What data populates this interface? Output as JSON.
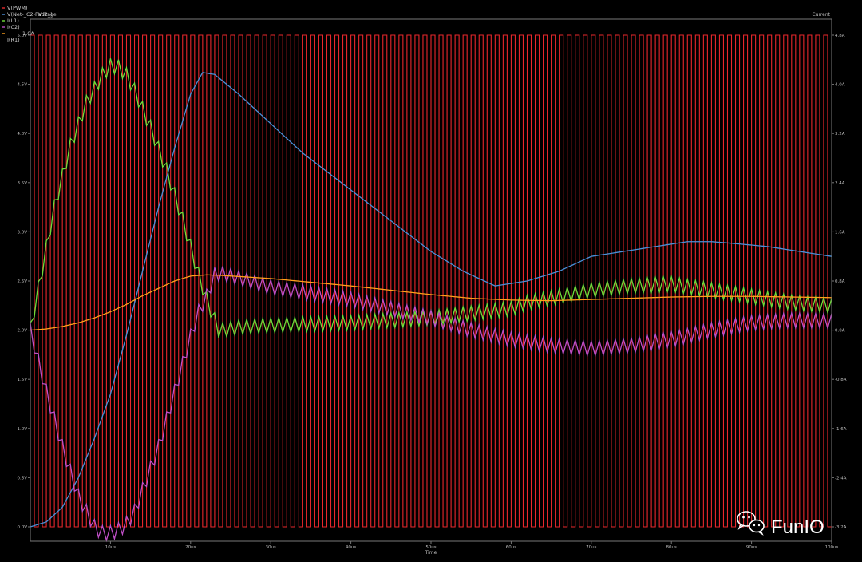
{
  "chart_data": {
    "type": "line",
    "left_axis_title": "Voltage",
    "right_axis_title": "Current",
    "x_axis_title": "Time",
    "x_ticks": [
      "10us",
      "20us",
      "30us",
      "40us",
      "50us",
      "60us",
      "70us",
      "80us",
      "90us",
      "100us"
    ],
    "left_ticks": [
      "0.0V",
      "0.5V",
      "1.0V",
      "1.5V",
      "2.0V",
      "2.5V",
      "3.0V",
      "3.5V",
      "4.0V",
      "4.5V",
      "5.0V"
    ],
    "right_ticks": [
      "-3.2A",
      "-2.4A",
      "-1.6A",
      "-0.8A",
      "0.0A",
      "0.8A",
      "1.6A",
      "2.4A",
      "3.2A",
      "4.0A",
      "4.8A"
    ],
    "xlim": [
      0,
      100
    ],
    "left_ylim": [
      0,
      5.0
    ],
    "right_ylim": [
      -3.2,
      4.8
    ],
    "grid": false,
    "legend_placement": "top-left",
    "legend": [
      "V(PWM)",
      "V(Net-_C2-Pad2_)",
      "I(L1)",
      "I(C2)",
      "I(R1)"
    ],
    "legend_extra": "1.0A",
    "colors": {
      "pwm": "#e8272c",
      "net": "#4a90d9",
      "il1": "#6fdc3a",
      "ic2": "#c04fc8",
      "ir1": "#ff9f1a",
      "background": "#000000",
      "axis": "#777777"
    },
    "series": [
      {
        "name": "V(PWM)",
        "axis": "left",
        "kind": "square_wave",
        "low": 0,
        "high": 5.0,
        "period_us": 1.0,
        "duty": 0.5
      },
      {
        "name": "V(Net-_C2-Pad2_)",
        "axis": "left",
        "x": [
          0,
          2,
          4,
          6,
          8,
          10,
          12,
          14,
          16,
          18,
          20,
          21.5,
          23,
          26,
          30,
          34,
          38,
          42,
          46,
          50,
          54,
          58,
          62,
          66,
          70,
          74,
          78,
          82,
          85,
          88,
          92,
          96,
          100
        ],
        "y": [
          0.0,
          0.05,
          0.2,
          0.5,
          0.9,
          1.35,
          1.95,
          2.6,
          3.25,
          3.85,
          4.4,
          4.62,
          4.6,
          4.4,
          4.1,
          3.8,
          3.55,
          3.3,
          3.05,
          2.8,
          2.6,
          2.45,
          2.5,
          2.6,
          2.75,
          2.8,
          2.85,
          2.9,
          2.9,
          2.88,
          2.85,
          2.8,
          2.75
        ]
      },
      {
        "name": "I(L1)",
        "axis": "right",
        "x": [
          0,
          1.5,
          3,
          5,
          7,
          9,
          10,
          11,
          12,
          13,
          15,
          17,
          19,
          21,
          22,
          23.5,
          24,
          26,
          30,
          40,
          50,
          60,
          62,
          66,
          70,
          75,
          80,
          85,
          90,
          95,
          100
        ],
        "y": [
          0.0,
          1.0,
          2.0,
          3.0,
          3.7,
          4.15,
          4.3,
          4.28,
          4.15,
          3.9,
          3.3,
          2.6,
          1.8,
          0.9,
          0.5,
          0.0,
          0.0,
          0.05,
          0.08,
          0.12,
          0.2,
          0.35,
          0.45,
          0.55,
          0.65,
          0.72,
          0.75,
          0.65,
          0.55,
          0.45,
          0.4
        ],
        "ripple": 0.12
      },
      {
        "name": "I(C2)",
        "axis": "right",
        "x": [
          0,
          2,
          4,
          6,
          8,
          9,
          10,
          11,
          12,
          13,
          14,
          16,
          18,
          20,
          21,
          22,
          23,
          24,
          26,
          30,
          40,
          50,
          55,
          60,
          65,
          70,
          75,
          80,
          85,
          90,
          95,
          100
        ],
        "y": [
          0.0,
          -1.0,
          -1.9,
          -2.7,
          -3.2,
          -3.3,
          -3.3,
          -3.25,
          -3.15,
          -2.95,
          -2.6,
          -1.9,
          -1.0,
          -0.1,
          0.3,
          0.55,
          0.9,
          0.92,
          0.85,
          0.7,
          0.5,
          0.2,
          0.0,
          -0.15,
          -0.25,
          -0.3,
          -0.25,
          -0.15,
          0.0,
          0.12,
          0.16,
          0.15
        ],
        "ripple": 0.12
      },
      {
        "name": "I(R1)",
        "axis": "right",
        "x": [
          0,
          2,
          4,
          6,
          8,
          10,
          12,
          14,
          16,
          18,
          20,
          22,
          24,
          30,
          40,
          50,
          55,
          60,
          65,
          70,
          75,
          80,
          85,
          90,
          95,
          100
        ],
        "y": [
          0.0,
          0.02,
          0.06,
          0.12,
          0.2,
          0.3,
          0.42,
          0.56,
          0.68,
          0.8,
          0.88,
          0.9,
          0.89,
          0.84,
          0.72,
          0.58,
          0.52,
          0.49,
          0.48,
          0.5,
          0.52,
          0.54,
          0.55,
          0.55,
          0.54,
          0.53
        ]
      }
    ]
  },
  "watermark": {
    "text": "FunIO",
    "icon": "wechat-icon"
  }
}
